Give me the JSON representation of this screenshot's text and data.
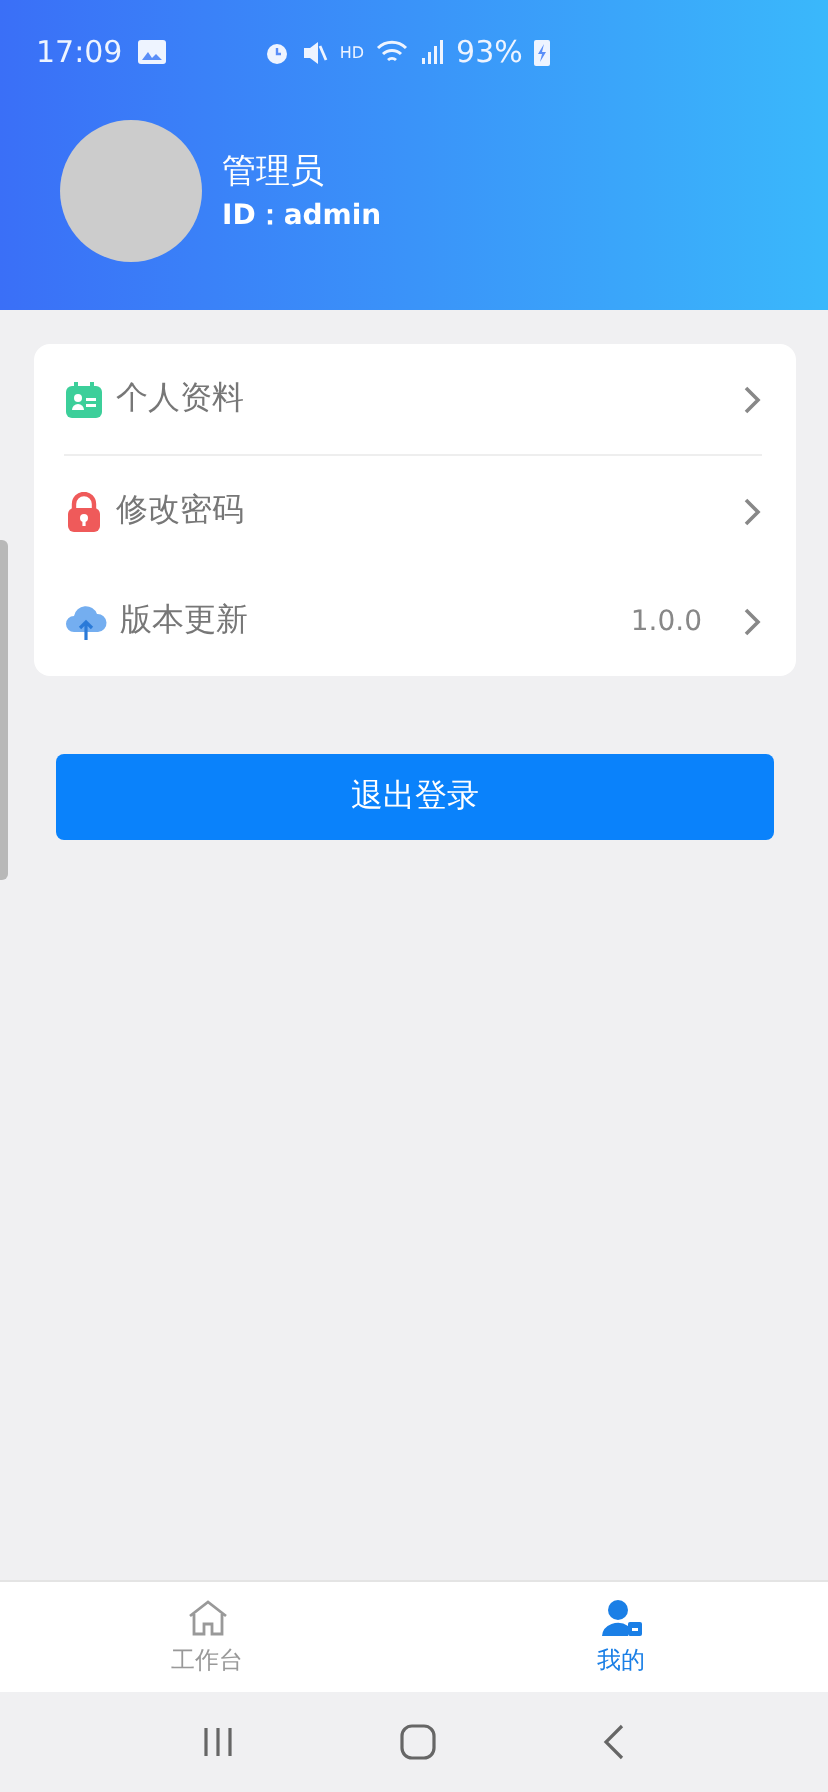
{
  "status_bar": {
    "time": "17:09",
    "network": "HD",
    "battery": "93%"
  },
  "profile": {
    "name": "管理员",
    "id": "ID：admin"
  },
  "menu": [
    {
      "kind": "profile",
      "label": "个人资料",
      "divider": true
    },
    {
      "kind": "password",
      "label": "修改密码",
      "divider": false
    },
    {
      "kind": "update",
      "label": "版本更新",
      "value": "1.0.0",
      "divider": false
    }
  ],
  "logout_button": "退出登录",
  "tabs": [
    {
      "kind": "home",
      "label": "工作台",
      "selected": false
    },
    {
      "kind": "mine",
      "label": "我的",
      "selected": true
    }
  ]
}
